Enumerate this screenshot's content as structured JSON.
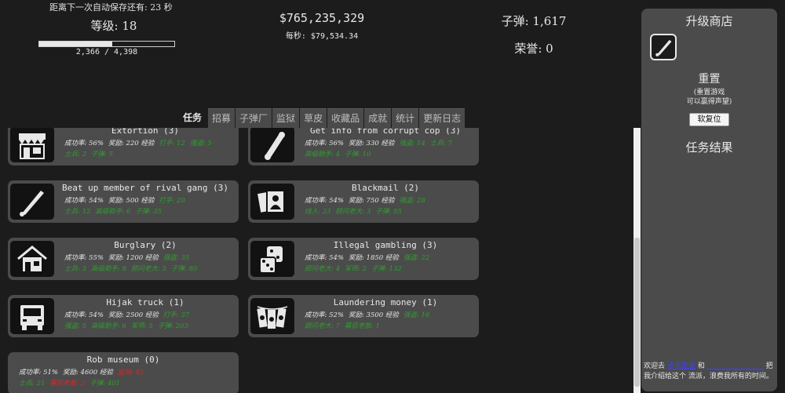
{
  "stats": {
    "autosave": "距离下一次自动保存还有: 23 秒",
    "level": "等级: 18",
    "xp_text": "2,366 / 4,398",
    "xp_progress": 0.538,
    "money": "$765,235,329",
    "per_sec": "每秒: $79,534.34",
    "ammo": "子弹: 1,617",
    "honor": "荣誉: 0"
  },
  "tabs": [
    "任务",
    "招募",
    "子弹厂",
    "监狱",
    "草皮",
    "收藏品",
    "成就",
    "统计",
    "更新日志"
  ],
  "tasks": [
    {
      "title": "Extortion (3)",
      "icon": "storefront-icon",
      "line1": [
        {
          "t": "成功率: 56%",
          "c": "w"
        },
        {
          "t": "奖励: 220 经验",
          "c": "w"
        },
        {
          "t": "打手: 12",
          "c": "g"
        },
        {
          "t": "强盗: 5",
          "c": "g"
        }
      ],
      "line2": [
        {
          "t": "士兵: 2",
          "c": "g"
        },
        {
          "t": "子弹: 5",
          "c": "g"
        }
      ]
    },
    {
      "title": "Get info from corrupt cop (3)",
      "icon": "scroll-icon",
      "line1": [
        {
          "t": "成功率: 56%",
          "c": "w"
        },
        {
          "t": "奖励: 330 经验",
          "c": "w"
        },
        {
          "t": "强盗: 14",
          "c": "g"
        },
        {
          "t": "士兵: 7",
          "c": "g"
        }
      ],
      "line2": [
        {
          "t": "高级助手: 4",
          "c": "g"
        },
        {
          "t": "子弹: 10",
          "c": "g"
        }
      ]
    },
    {
      "title": "Beat up member of rival gang (3)",
      "icon": "baseball-bat-icon",
      "line1": [
        {
          "t": "成功率: 54%",
          "c": "w"
        },
        {
          "t": "奖励: 500 经验",
          "c": "w"
        },
        {
          "t": "打手: 20",
          "c": "g"
        }
      ],
      "line2": [
        {
          "t": "士兵: 12",
          "c": "g"
        },
        {
          "t": "高级助手: 6",
          "c": "g"
        },
        {
          "t": "子弹: 35",
          "c": "g"
        }
      ]
    },
    {
      "title": "Blackmail (2)",
      "icon": "photos-icon",
      "line1": [
        {
          "t": "成功率: 54%",
          "c": "w"
        },
        {
          "t": "奖励: 750 经验",
          "c": "w"
        },
        {
          "t": "强盗: 28",
          "c": "g"
        }
      ],
      "line2": [
        {
          "t": "线人: 23",
          "c": "g"
        },
        {
          "t": "顾问老大: 3",
          "c": "g"
        },
        {
          "t": "子弹: 55",
          "c": "g"
        }
      ]
    },
    {
      "title": "Burglary (2)",
      "icon": "house-icon",
      "line1": [
        {
          "t": "成功率: 55%",
          "c": "w"
        },
        {
          "t": "奖励: 1200 经验",
          "c": "w"
        },
        {
          "t": "强盗: 35",
          "c": "g"
        }
      ],
      "line2": [
        {
          "t": "士兵: 3",
          "c": "g"
        },
        {
          "t": "高级助手: 8",
          "c": "g"
        },
        {
          "t": "顾问老大: 5",
          "c": "g"
        },
        {
          "t": "子弹: 80",
          "c": "g"
        }
      ]
    },
    {
      "title": "Illegal gambling (3)",
      "icon": "dice-icon",
      "line1": [
        {
          "t": "成功率: 54%",
          "c": "w"
        },
        {
          "t": "奖励: 1850 经验",
          "c": "w"
        },
        {
          "t": "强盗: 22",
          "c": "g"
        }
      ],
      "line2": [
        {
          "t": "顾问老大: 4",
          "c": "g"
        },
        {
          "t": "军师: 2",
          "c": "g"
        },
        {
          "t": "子弹: 132",
          "c": "g"
        }
      ]
    },
    {
      "title": "Hijak truck (1)",
      "icon": "truck-icon",
      "line1": [
        {
          "t": "成功率: 54%",
          "c": "w"
        },
        {
          "t": "奖励: 2500 经验",
          "c": "w"
        },
        {
          "t": "打手: 37",
          "c": "g"
        }
      ],
      "line2": [
        {
          "t": "强盗: 5",
          "c": "g"
        },
        {
          "t": "高级助手: 6",
          "c": "g"
        },
        {
          "t": "军师: 5",
          "c": "g"
        },
        {
          "t": "子弹: 203",
          "c": "g"
        }
      ]
    },
    {
      "title": "Laundering money (1)",
      "icon": "money-laundering-icon",
      "line1": [
        {
          "t": "成功率: 52%",
          "c": "w"
        },
        {
          "t": "奖励: 3500 经验",
          "c": "w"
        },
        {
          "t": "强盗: 16",
          "c": "g"
        }
      ],
      "line2": [
        {
          "t": "顾问老大: 7",
          "c": "g"
        },
        {
          "t": "幕后老板: 1",
          "c": "g"
        }
      ]
    },
    {
      "title": "Rob museum (0)",
      "icon": "",
      "line1": [
        {
          "t": "成功率: 51%",
          "c": "w"
        },
        {
          "t": "奖励: 4600 经验",
          "c": "w"
        },
        {
          "t": "监狱: 42",
          "c": "r"
        }
      ],
      "line2": [
        {
          "t": "士兵: 21",
          "c": "g"
        },
        {
          "t": "幕后老板: 2",
          "c": "r"
        },
        {
          "t": "子弹: 401",
          "c": "g"
        }
      ]
    }
  ],
  "panel": {
    "shop_title": "升级商店",
    "upgrade_icon": "baseball-bat-icon",
    "reset_title": "重置",
    "reset_note_1": "(重置游戏",
    "reset_note_2": "可以赢得声望)",
    "reset_button": "软复位",
    "results_title": "任务结果",
    "footer_a": "欢迎去",
    "footer_link": "点击这里",
    "footer_b": "和",
    "footer_link2": "________________",
    "footer_c": "把我介绍给这个",
    "footer_d": "流派，浪费我所有的时间。"
  },
  "colors": {
    "background": "#1c1c1c",
    "card": "#4b4b4b",
    "green": "#2f9e2f",
    "red": "#e52222",
    "link": "#4040ff"
  }
}
